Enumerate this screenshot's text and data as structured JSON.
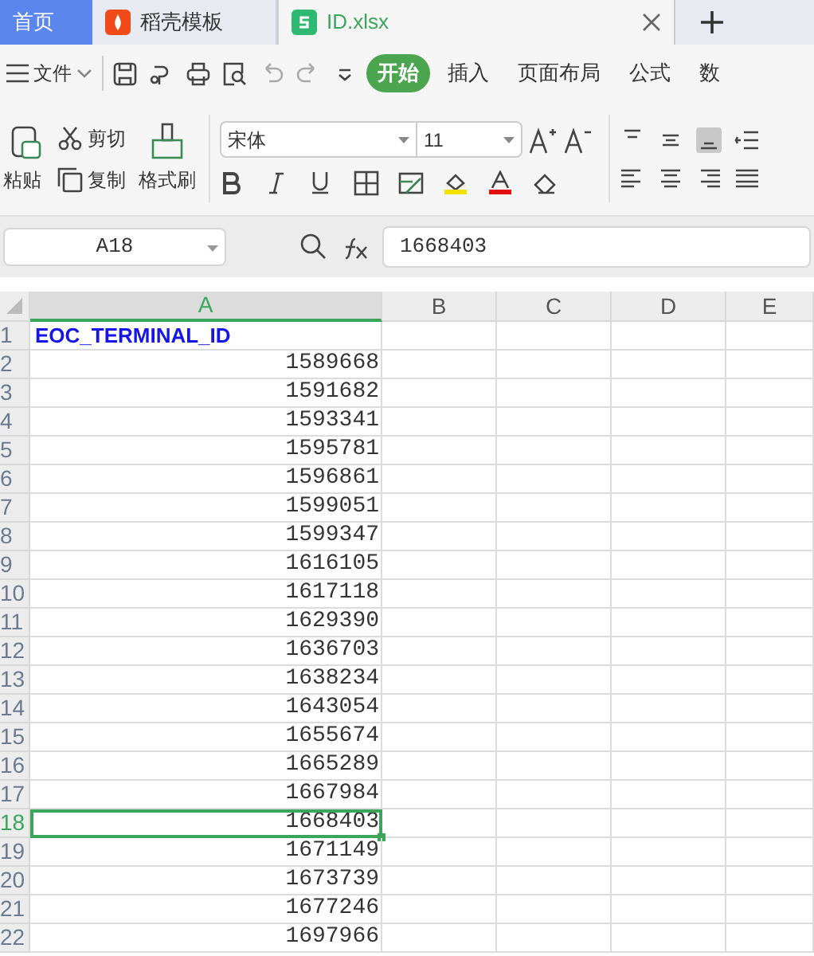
{
  "tabs": [
    {
      "kind": "home",
      "label": "首页",
      "selected": false
    },
    {
      "kind": "docer",
      "label": "稻壳模板",
      "selected": false
    },
    {
      "kind": "sheet",
      "label": "ID.xlsx",
      "selected": true
    }
  ],
  "menu": {
    "file_label": "文件",
    "tabs": [
      {
        "label": "开始",
        "selected": true
      },
      {
        "label": "插入",
        "selected": false
      },
      {
        "label": "页面布局",
        "selected": false
      },
      {
        "label": "公式",
        "selected": false
      },
      {
        "label": "数",
        "selected": false
      }
    ]
  },
  "ribbon": {
    "paste": "粘贴",
    "cut": "剪切",
    "copy": "复制",
    "format_painter": "格式刷",
    "font": "宋体",
    "font_size": "11"
  },
  "formula_bar": {
    "name_box": "A18",
    "value": "1668403"
  },
  "sheet": {
    "columns": [
      {
        "label": "A",
        "selected": true
      },
      {
        "label": "B",
        "selected": false
      },
      {
        "label": "C",
        "selected": false
      },
      {
        "label": "D",
        "selected": false
      },
      {
        "label": "E",
        "selected": false
      }
    ],
    "rows": [
      {
        "number": "1",
        "value": "EOC_TERMINAL_ID",
        "kind": "header",
        "selected": false
      },
      {
        "number": "2",
        "value": "1589668",
        "kind": "number",
        "selected": false
      },
      {
        "number": "3",
        "value": "1591682",
        "kind": "number",
        "selected": false
      },
      {
        "number": "4",
        "value": "1593341",
        "kind": "number",
        "selected": false
      },
      {
        "number": "5",
        "value": "1595781",
        "kind": "number",
        "selected": false
      },
      {
        "number": "6",
        "value": "1596861",
        "kind": "number",
        "selected": false
      },
      {
        "number": "7",
        "value": "1599051",
        "kind": "number",
        "selected": false
      },
      {
        "number": "8",
        "value": "1599347",
        "kind": "number",
        "selected": false
      },
      {
        "number": "9",
        "value": "1616105",
        "kind": "number",
        "selected": false
      },
      {
        "number": "10",
        "value": "1617118",
        "kind": "number",
        "selected": false
      },
      {
        "number": "11",
        "value": "1629390",
        "kind": "number",
        "selected": false
      },
      {
        "number": "12",
        "value": "1636703",
        "kind": "number",
        "selected": false
      },
      {
        "number": "13",
        "value": "1638234",
        "kind": "number",
        "selected": false
      },
      {
        "number": "14",
        "value": "1643054",
        "kind": "number",
        "selected": false
      },
      {
        "number": "15",
        "value": "1655674",
        "kind": "number",
        "selected": false
      },
      {
        "number": "16",
        "value": "1665289",
        "kind": "number",
        "selected": false
      },
      {
        "number": "17",
        "value": "1667984",
        "kind": "number",
        "selected": false
      },
      {
        "number": "18",
        "value": "1668403",
        "kind": "number",
        "selected": true
      },
      {
        "number": "19",
        "value": "1671149",
        "kind": "number",
        "selected": false
      },
      {
        "number": "20",
        "value": "1673739",
        "kind": "number",
        "selected": false
      },
      {
        "number": "21",
        "value": "1677246",
        "kind": "number",
        "selected": false
      },
      {
        "number": "22",
        "value": "1697966",
        "kind": "number",
        "selected": false
      }
    ]
  }
}
